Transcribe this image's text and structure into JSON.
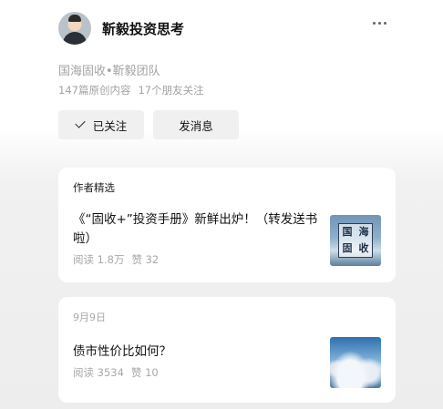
{
  "account": {
    "name": "靳毅投资思考",
    "org": "国海固收•靳毅团队",
    "original_count": "147篇原创内容",
    "friends_following": "17个朋友关注"
  },
  "actions": {
    "follow_label": "已关注",
    "message_label": "发消息"
  },
  "featured": {
    "heading": "作者精选",
    "article": {
      "title": "《“固收+”投资手册》新鲜出炉！（转发送书啦）",
      "reads": "阅读 1.8万",
      "likes": "赞 32",
      "thumb_seal": [
        "国",
        "海",
        "固",
        "收"
      ]
    }
  },
  "dated": {
    "date": "9月9日",
    "article": {
      "title": "债市性价比如何？",
      "reads": "阅读 3534",
      "likes": "赞 10"
    }
  },
  "icons": {
    "more": "more-horizontal-icon",
    "follow": "check-icon"
  },
  "colors": {
    "muted_text": "#a3a3a3",
    "button_bg": "#f0f0f0",
    "card_bg": "#ffffff",
    "page_bg": "#ededed"
  }
}
